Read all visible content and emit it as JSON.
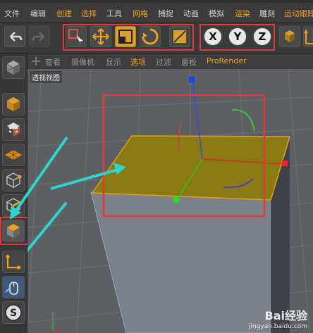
{
  "menubar": {
    "items": [
      "文件",
      "编辑",
      "创建",
      "选择",
      "工具",
      "网格",
      "捕捉",
      "动画",
      "模拟",
      "渲染",
      "雕刻",
      "运动跟踪"
    ],
    "active": [
      2,
      3,
      5,
      9
    ]
  },
  "toolbar": {
    "axis_buttons": [
      "X",
      "Y",
      "Z"
    ],
    "icons": [
      "undo-icon",
      "redo-icon",
      "live-select-icon",
      "move-icon",
      "scale-icon",
      "rotate-icon",
      "last-tool-icon",
      "world-coordinates-icon"
    ]
  },
  "sidebar": {
    "icons": [
      "make-editable-icon",
      "model-mode-icon",
      "texture-mode-icon",
      "workplane-icon",
      "point-mode-icon",
      "edge-mode-icon",
      "polygon-mode-icon",
      "axis-mode-icon",
      "tweak-mode-icon",
      "snap-icon"
    ]
  },
  "viewport_menu": {
    "items": [
      "查看",
      "摄像机",
      "显示",
      "选项",
      "过滤",
      "面板",
      "ProRender"
    ],
    "highlight": [
      3,
      6
    ]
  },
  "viewport": {
    "label": "透视视图"
  },
  "watermark": {
    "main": "Bai经验",
    "url": "jingyan.baidu.com"
  },
  "colors": {
    "selection_box": "#e03a3a",
    "annotation_arrow": "#2fd4d0",
    "polygon_fill": "#8a7a12",
    "accent": "#f0a020"
  }
}
